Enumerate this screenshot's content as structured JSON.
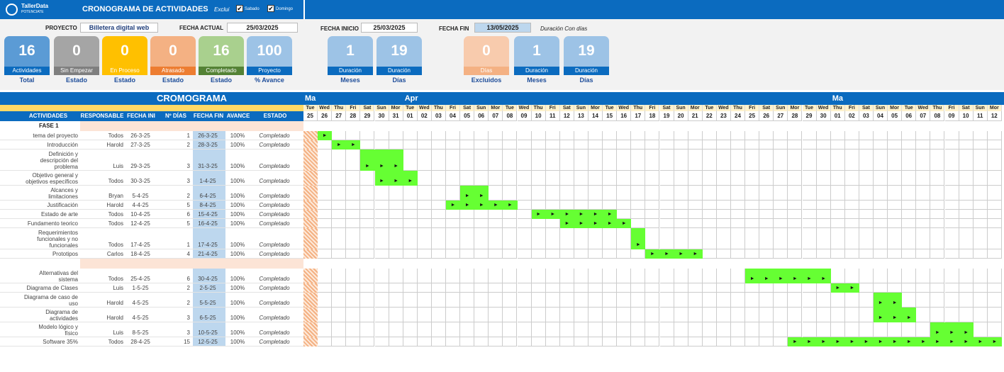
{
  "app": {
    "logo_name": "TallerData",
    "logo_sub": "POTENCIATE",
    "title": "CRONOGRAMA DE ACTIVIDADES",
    "exclude_label": "Exclui",
    "saturday": "Sabado",
    "sunday": "Domingo",
    "saturday_checked": true,
    "sunday_checked": true
  },
  "project": {
    "label": "PROYECTO",
    "name": "Billetera digital web",
    "current_date_label": "FECHA ACTUAL",
    "current_date": "25/03/2025",
    "start_label": "FECHA INICIO",
    "start_date": "25/03/2025",
    "end_label": "FECHA FIN",
    "end_date": "13/05/2025",
    "duration_note": "Duración Con días"
  },
  "stats": [
    {
      "value": "16",
      "label": "Actividades",
      "caption": "Total",
      "color": "#5b9bd5",
      "label_bg": "#0b6bbf"
    },
    {
      "value": "0",
      "label": "Sin Empezar",
      "caption": "Estado",
      "color": "#a5a5a5",
      "label_bg": "#7f7f7f"
    },
    {
      "value": "0",
      "label": "En Proceso",
      "caption": "Estado",
      "color": "#ffc000",
      "label_bg": "#ffc000"
    },
    {
      "value": "0",
      "label": "Atrasado",
      "caption": "Estado",
      "color": "#f4b183",
      "label_bg": "#ed7d31"
    },
    {
      "value": "16",
      "label": "Completado",
      "caption": "Estado",
      "color": "#a9d08e",
      "label_bg": "#548235"
    },
    {
      "value": "100",
      "label": "Proyecto",
      "caption": "% Avance",
      "color": "#9dc3e6",
      "label_bg": "#0b6bbf"
    }
  ],
  "durations": [
    {
      "value": "1",
      "label": "Duración",
      "caption": "Meses",
      "color": "#9dc3e6",
      "label_bg": "#0b6bbf"
    },
    {
      "value": "19",
      "label": "Duración",
      "caption": "Días",
      "color": "#9dc3e6",
      "label_bg": "#0b6bbf"
    },
    {
      "value": "0",
      "label": "Días",
      "caption": "Excluidos",
      "color": "#f8cbad",
      "label_bg": "#f4b183"
    },
    {
      "value": "1",
      "label": "Duración",
      "caption": "Meses",
      "color": "#9dc3e6",
      "label_bg": "#0b6bbf"
    },
    {
      "value": "19",
      "label": "Duración",
      "caption": "Días",
      "color": "#9dc3e6",
      "label_bg": "#0b6bbf"
    }
  ],
  "gantt": {
    "section_title": "CROMOGRAMA",
    "columns": {
      "activity": "ACTIVIDADES",
      "owner": "RESPONSABLE",
      "start": "FECHA INI",
      "days": "Nº DÍAS",
      "end": "FECHA FIN",
      "progress": "AVANCE",
      "status": "ESTADO"
    },
    "month_labels": [
      {
        "text": "Ma",
        "day_index": 0
      },
      {
        "text": "Apr",
        "day_index": 7
      },
      {
        "text": "Ma",
        "day_index": 37
      }
    ],
    "weekdays": [
      "Tue",
      "Wed",
      "Thu",
      "Fri",
      "Sat",
      "Sun",
      "Mon",
      "Tue",
      "Wed",
      "Thu",
      "Fri",
      "Sat",
      "Sun",
      "Mon",
      "Tue",
      "Wed",
      "Thu",
      "Fri",
      "Sat",
      "Sun",
      "Mon",
      "Tue",
      "Wed",
      "Thu",
      "Fri",
      "Sat",
      "Sun",
      "Mon",
      "Tue",
      "Wed",
      "Thu",
      "Fri",
      "Sat",
      "Sun",
      "Mon",
      "Tue",
      "Wed",
      "Thu",
      "Fri",
      "Sat",
      "Sun",
      "Mon",
      "Tue",
      "Wed",
      "Thu",
      "Fri",
      "Sat",
      "Sun",
      "Mon"
    ],
    "weekdays_shown": [
      "Tue",
      "Wed",
      "Thu",
      "Fri",
      "Sat",
      "Sun",
      "Mor",
      "Tue",
      "Wed",
      "Thu",
      "Fri",
      "Sat",
      "Sun",
      "Mor",
      "Tue",
      "Wed",
      "Thu",
      "Fri",
      "Sat",
      "Sun",
      "Mor",
      "Tue",
      "Wed",
      "Thu",
      "Fri",
      "Sat",
      "Sun",
      "Mor",
      "Tue",
      "Wed",
      "Thu",
      "Fri",
      "Sat",
      "Sun",
      "Mor",
      "Tue",
      "Wed",
      "Thu",
      "Fri",
      "Sat",
      "Sun",
      "Mor",
      "Tue",
      "Wed",
      "Thu",
      "Fri",
      "Sat",
      "Sun",
      "Mor"
    ],
    "days": [
      "25",
      "26",
      "27",
      "28",
      "29",
      "30",
      "31",
      "01",
      "02",
      "03",
      "04",
      "05",
      "06",
      "07",
      "08",
      "09",
      "10",
      "11",
      "12",
      "13",
      "14",
      "15",
      "16",
      "17",
      "18",
      "19",
      "20",
      "21",
      "22",
      "23",
      "24",
      "25",
      "26",
      "27",
      "28",
      "29",
      "30",
      "01",
      "02",
      "03",
      "04",
      "05",
      "06",
      "07",
      "08",
      "09",
      "10",
      "11",
      "12"
    ],
    "phase": "FASE 1",
    "rows": [
      {
        "name": [
          "tema del proyecto"
        ],
        "owner": "Todos",
        "start": "26-3-25",
        "days": "1",
        "end": "26-3-25",
        "progress": "100%",
        "status": "Completado",
        "bar_start": 1,
        "bar_len": 1,
        "arrows": 1
      },
      {
        "name": [
          "Introducción"
        ],
        "owner": "Harold",
        "start": "27-3-25",
        "days": "2",
        "end": "28-3-25",
        "progress": "100%",
        "status": "Completado",
        "bar_start": 2,
        "bar_len": 2,
        "arrows": 2
      },
      {
        "name": [
          "Definición y",
          "descripción del",
          "problema"
        ],
        "owner": "Luis",
        "start": "29-3-25",
        "days": "3",
        "end": "31-3-25",
        "progress": "100%",
        "status": "Completado",
        "bar_start": 4,
        "bar_len": 3,
        "arrows": 3
      },
      {
        "name": [
          "Objetivo general y",
          "objetivos específicos"
        ],
        "owner": "Todos",
        "start": "30-3-25",
        "days": "3",
        "end": "1-4-25",
        "progress": "100%",
        "status": "Completado",
        "bar_start": 5,
        "bar_len": 3,
        "arrows": 3
      },
      {
        "name": [
          "Alcances y",
          "limitaciones"
        ],
        "owner": "Bryan",
        "start": "5-4-25",
        "days": "2",
        "end": "6-4-25",
        "progress": "100%",
        "status": "Completado",
        "bar_start": 11,
        "bar_len": 2,
        "arrows": 2
      },
      {
        "name": [
          "Justificación"
        ],
        "owner": "Harold",
        "start": "4-4-25",
        "days": "5",
        "end": "8-4-25",
        "progress": "100%",
        "status": "Completado",
        "bar_start": 10,
        "bar_len": 5,
        "arrows": 5
      },
      {
        "name": [
          "Estado de arte"
        ],
        "owner": "Todos",
        "start": "10-4-25",
        "days": "6",
        "end": "15-4-25",
        "progress": "100%",
        "status": "Completado",
        "bar_start": 16,
        "bar_len": 6,
        "arrows": 6
      },
      {
        "name": [
          "Fundamento teorico"
        ],
        "owner": "Todos",
        "start": "12-4-25",
        "days": "5",
        "end": "16-4-25",
        "progress": "100%",
        "status": "Completado",
        "bar_start": 18,
        "bar_len": 5,
        "arrows": 5
      },
      {
        "name": [
          "Requerimientos",
          "funcionales y no",
          "funcionales"
        ],
        "owner": "Todos",
        "start": "17-4-25",
        "days": "1",
        "end": "17-4-25",
        "progress": "100%",
        "status": "Completado",
        "bar_start": 23,
        "bar_len": 1,
        "arrows": 1
      },
      {
        "name": [
          "Prototipos"
        ],
        "owner": "Carlos",
        "start": "18-4-25",
        "days": "4",
        "end": "21-4-25",
        "progress": "100%",
        "status": "Completado",
        "bar_start": 24,
        "bar_len": 4,
        "arrows": 4
      },
      {
        "separator": true
      },
      {
        "name": [
          "Alternativas del",
          "sistema"
        ],
        "owner": "Todos",
        "start": "25-4-25",
        "days": "6",
        "end": "30-4-25",
        "progress": "100%",
        "status": "Completado",
        "bar_start": 31,
        "bar_len": 6,
        "arrows": 6
      },
      {
        "name": [
          "Diagrama de Clases"
        ],
        "owner": "Luis",
        "start": "1-5-25",
        "days": "2",
        "end": "2-5-25",
        "progress": "100%",
        "status": "Completado",
        "bar_start": 37,
        "bar_len": 2,
        "arrows": 2
      },
      {
        "name": [
          "Diagrama de caso de",
          "uso"
        ],
        "owner": "Harold",
        "start": "4-5-25",
        "days": "2",
        "end": "5-5-25",
        "progress": "100%",
        "status": "Completado",
        "bar_start": 40,
        "bar_len": 2,
        "arrows": 2
      },
      {
        "name": [
          "Diagrama de",
          "actividades"
        ],
        "owner": "Harold",
        "start": "4-5-25",
        "days": "3",
        "end": "6-5-25",
        "progress": "100%",
        "status": "Completado",
        "bar_start": 40,
        "bar_len": 3,
        "arrows": 3
      },
      {
        "name": [
          "Modelo lógico y",
          "físico"
        ],
        "owner": "Luis",
        "start": "8-5-25",
        "days": "3",
        "end": "10-5-25",
        "progress": "100%",
        "status": "Completado",
        "bar_start": 44,
        "bar_len": 3,
        "arrows": 3
      },
      {
        "name": [
          "Software 35%"
        ],
        "owner": "Todos",
        "start": "28-4-25",
        "days": "15",
        "end": "12-5-25",
        "progress": "100%",
        "status": "Completado",
        "bar_start": 34,
        "bar_len": 15,
        "arrows": 15
      }
    ]
  }
}
